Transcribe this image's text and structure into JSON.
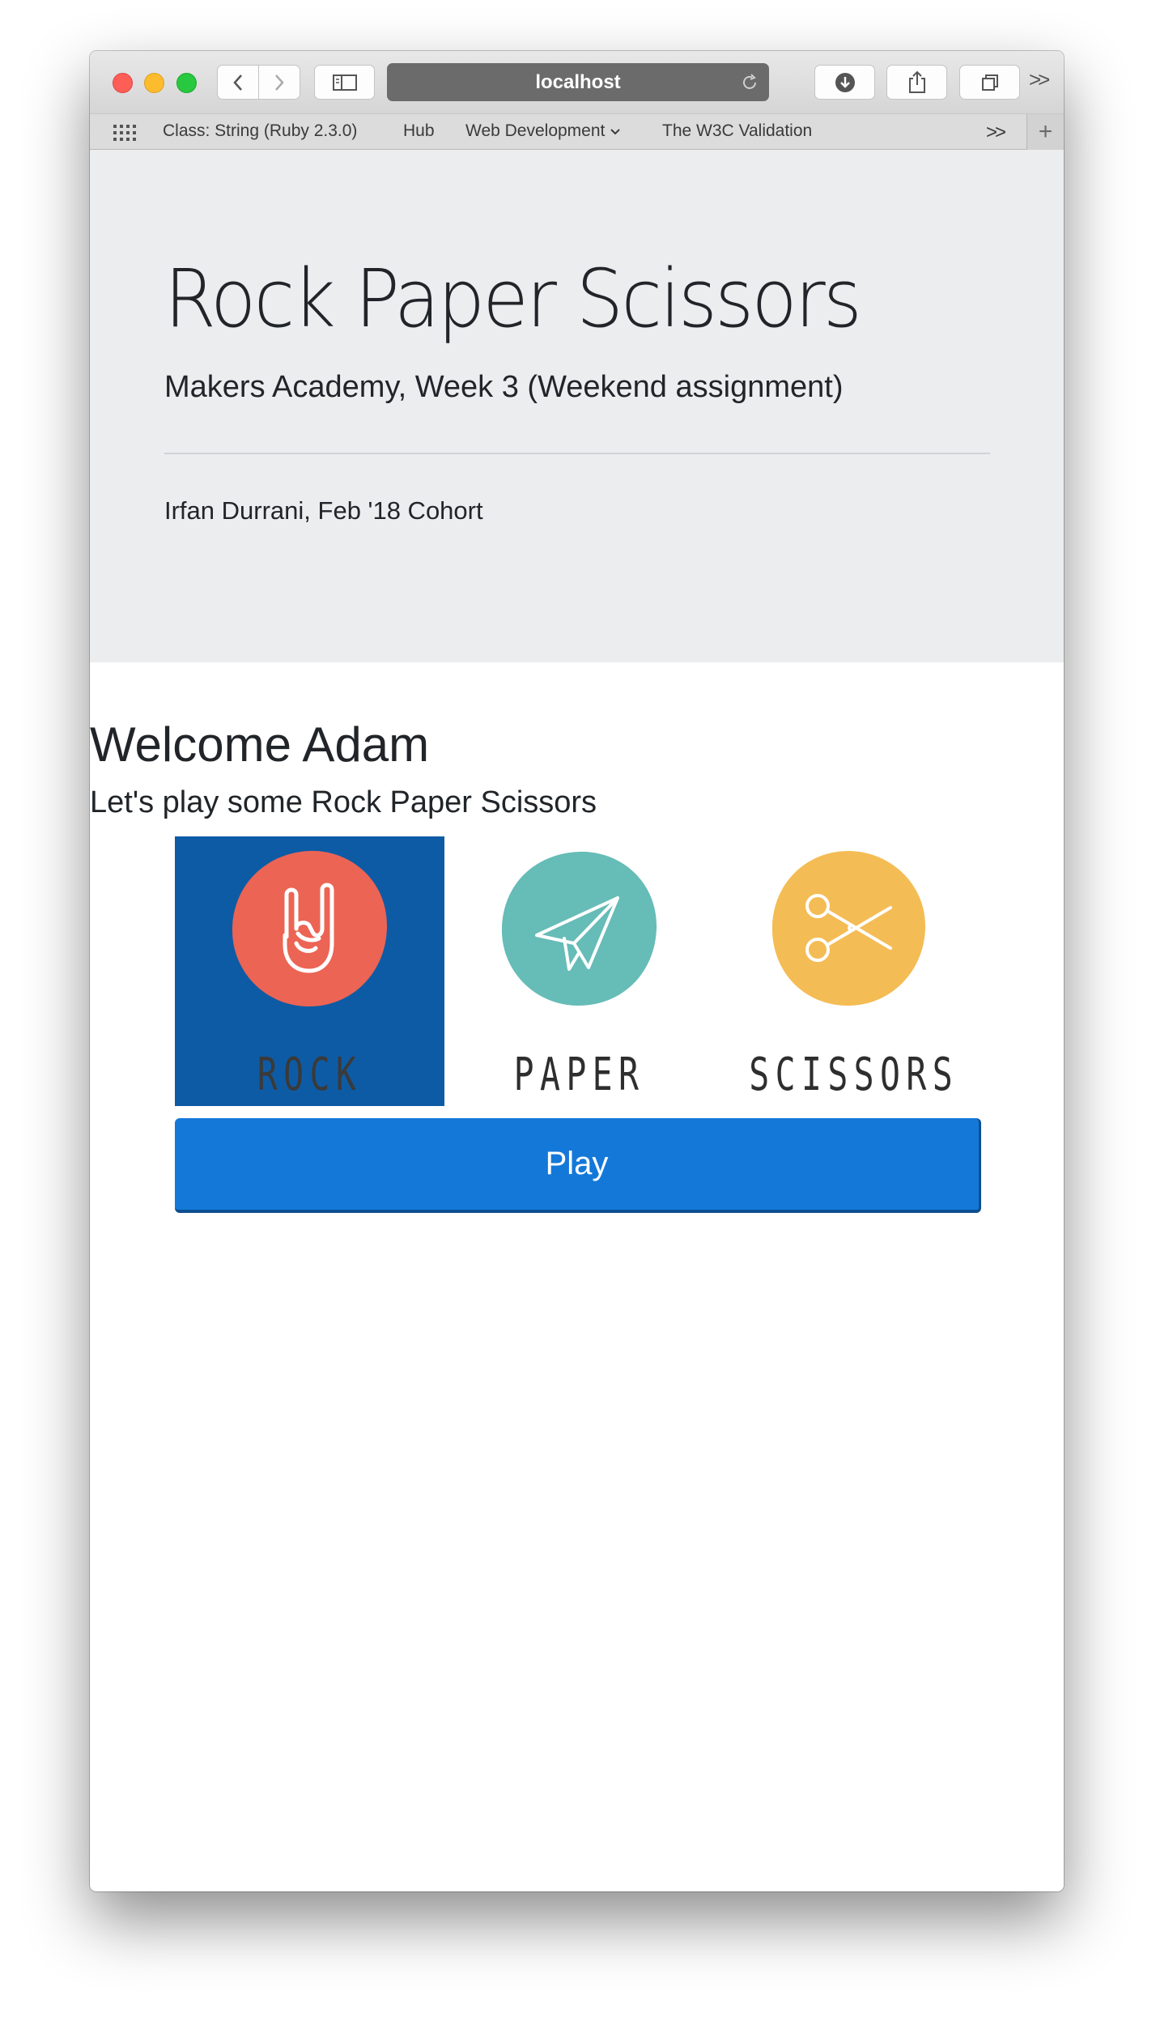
{
  "browser": {
    "url": "localhost",
    "bookmarks": [
      "Class: String (Ruby 2.3.0)",
      "Hub",
      "Web Development",
      "The W3C Validation"
    ],
    "overflow": ">>"
  },
  "jumbotron": {
    "title": "Rock Paper Scissors",
    "lead": "Makers Academy, Week 3 (Weekend assignment)",
    "author": "Irfan Durrani, Feb '18 Cohort"
  },
  "game": {
    "welcome": "Welcome Adam",
    "subtitle": "Let's play some Rock Paper Scissors",
    "choices": [
      {
        "label": "ROCK",
        "icon": "rock-hand-icon",
        "color": "#ec6454",
        "selected": true
      },
      {
        "label": "PAPER",
        "icon": "paper-plane-icon",
        "color": "#66bcb7",
        "selected": false
      },
      {
        "label": "SCISSORS",
        "icon": "scissors-icon",
        "color": "#f4bc54",
        "selected": false
      }
    ],
    "play_label": "Play"
  },
  "colors": {
    "selected_bg": "#0e5ba5",
    "play_button": "#1478d9",
    "jumbotron_bg": "#ecedef"
  }
}
